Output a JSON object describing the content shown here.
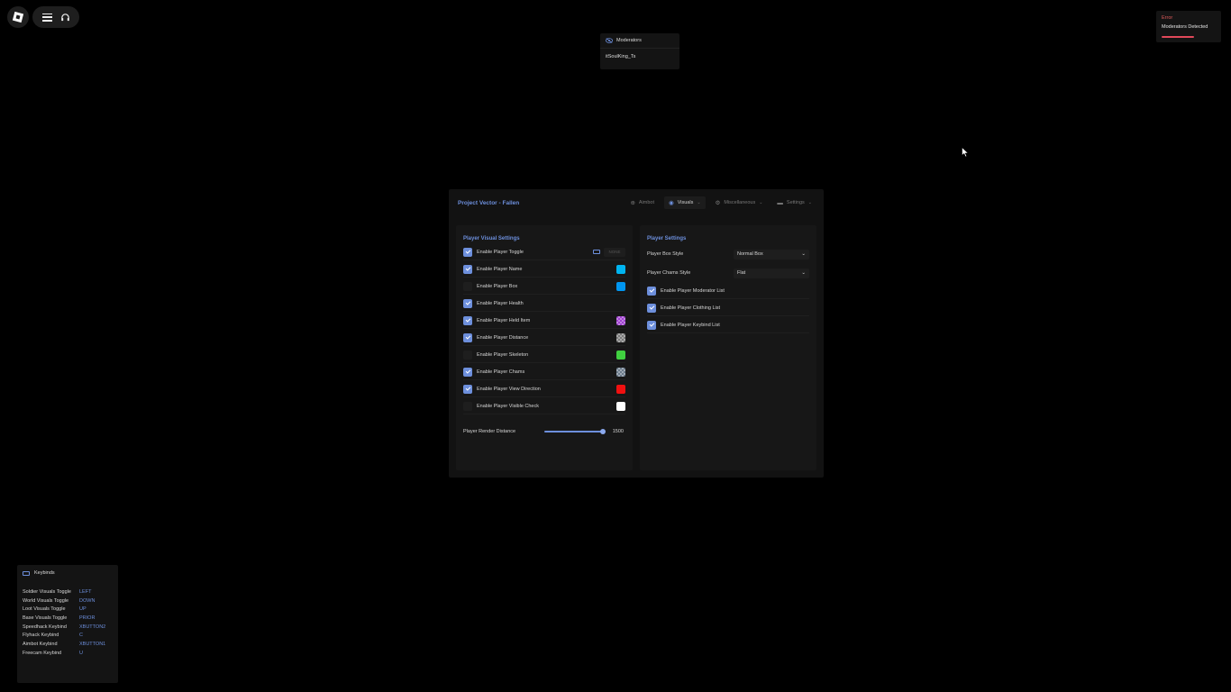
{
  "notification": {
    "title": "Error",
    "text": "Moderators Detected",
    "accent": "#e0485a"
  },
  "moderators": {
    "title": "Moderators",
    "items": [
      "itSoulKing_Ts"
    ]
  },
  "window": {
    "title": "Project Vector - Fallen",
    "tabs": [
      {
        "label": "Aimbot",
        "icon": "crosshair-icon",
        "active": false
      },
      {
        "label": "Visuals",
        "icon": "eye-icon",
        "active": true
      },
      {
        "label": "Miscellaneous",
        "icon": "gear-icon",
        "active": false
      },
      {
        "label": "Settings",
        "icon": "folder-icon",
        "active": false
      }
    ],
    "left": {
      "title": "Player Visual Settings",
      "rows": [
        {
          "label": "Enable Player Toggle",
          "checked": true,
          "keybind": "NONE"
        },
        {
          "label": "Enable Player Name",
          "checked": true,
          "color": "#00b4f0"
        },
        {
          "label": "Enable Player Box",
          "checked": false,
          "color": "#0096f0"
        },
        {
          "label": "Enable Player Health",
          "checked": true
        },
        {
          "label": "Enable Player Held Item",
          "checked": true,
          "color": "#a040d0"
        },
        {
          "label": "Enable Player Distance",
          "checked": true,
          "color": "#7a7a7a"
        },
        {
          "label": "Enable Player Skeleton",
          "checked": false,
          "color": "#40d040"
        },
        {
          "label": "Enable Player Chams",
          "checked": true,
          "color": "#6a7a8a"
        },
        {
          "label": "Enable Player View Direction",
          "checked": true,
          "color": "#f01010"
        },
        {
          "label": "Enable Player Visible Check",
          "checked": false,
          "color": "#ffffff"
        }
      ],
      "slider": {
        "label": "Player Render Distance",
        "value": "1500",
        "fraction": 0.98
      }
    },
    "right": {
      "title": "Player Settings",
      "dropdowns": [
        {
          "label": "Player Box Style",
          "value": "Normal Box"
        },
        {
          "label": "Player Chams Style",
          "value": "Flat"
        }
      ],
      "rows": [
        {
          "label": "Enable Player Moderator List",
          "checked": true
        },
        {
          "label": "Enable Player Clothing List",
          "checked": true
        },
        {
          "label": "Enable Player Keybind List",
          "checked": true
        }
      ]
    }
  },
  "keybinds": {
    "title": "Keybinds",
    "items": [
      {
        "name": "Soldier Visuals Toggle",
        "key": "LEFT"
      },
      {
        "name": "World Visuals Toggle",
        "key": "DOWN"
      },
      {
        "name": "Loot Visuals Toggle",
        "key": "UP"
      },
      {
        "name": "Base Visuals Toggle",
        "key": "PRIOR"
      },
      {
        "name": "Speedhack Keybind",
        "key": "XBUTTON2"
      },
      {
        "name": "Flyhack Keybind",
        "key": "C"
      },
      {
        "name": "Aimbot Keybind",
        "key": "XBUTTON1"
      },
      {
        "name": "Freecam Keybind",
        "key": "U"
      }
    ]
  },
  "colors": {
    "accent": "#6d8fdc",
    "panel": "#121212",
    "section": "#171717"
  }
}
